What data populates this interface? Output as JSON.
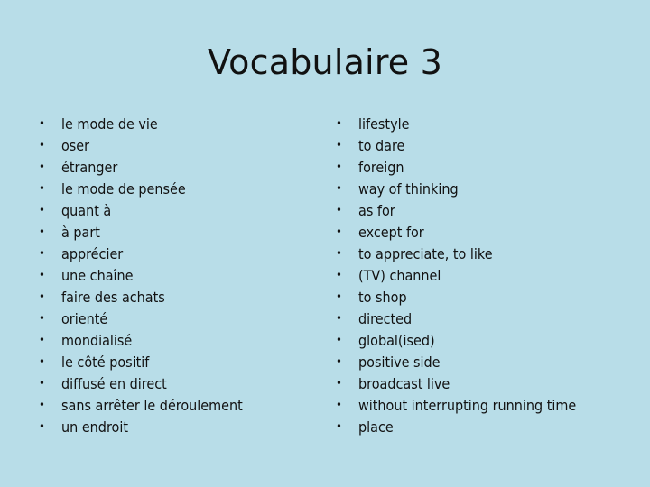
{
  "slide": {
    "title": "Vocabulaire 3",
    "background_color": "#b8dde8",
    "text_color": "#111111",
    "bullet_glyph": "•"
  },
  "columns": {
    "french": {
      "items": [
        "le mode de vie",
        "oser",
        "étranger",
        "le mode de pensée",
        "quant à",
        "à part",
        "apprécier",
        "une chaîne",
        "faire des achats",
        "orienté",
        "mondialisé",
        "le côté positif",
        "diffusé en direct",
        "sans arrêter le déroulement",
        "un endroit"
      ]
    },
    "english": {
      "items": [
        "lifestyle",
        "to dare",
        "foreign",
        "way of thinking",
        "as for",
        "except for",
        "to appreciate, to like",
        "(TV) channel",
        "to shop",
        "directed",
        "global(ised)",
        "positive side",
        "broadcast live",
        "without interrupting running time",
        "place"
      ]
    }
  }
}
